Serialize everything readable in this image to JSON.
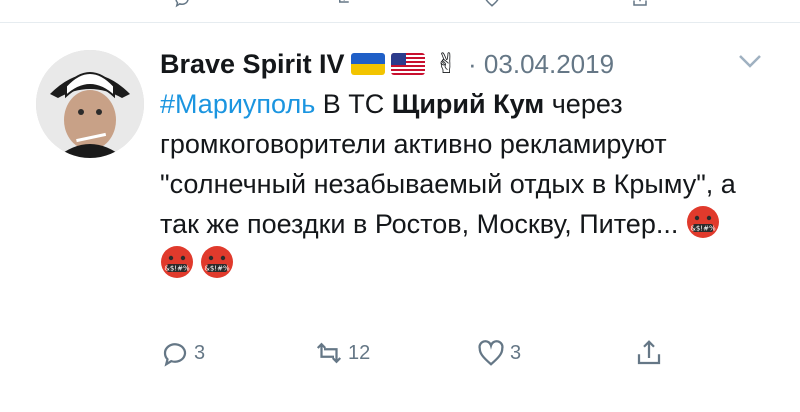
{
  "topbar": {
    "icons": [
      "reply-icon",
      "retweet-icon",
      "like-icon",
      "share-icon"
    ]
  },
  "tweet": {
    "author": {
      "display_name": "Brave Spirit IV"
    },
    "meta": "· 03.04.2019",
    "text": {
      "hashtag": "#Мариуполь",
      "part1": " В ТС ",
      "bold": "Щирий Кум",
      "part2": " через громкоговорители активно рекламируют \"солнечный незабываемый отдых в Крыму\", а так же поездки в Ростов, Москву, Питер... "
    },
    "emojis": [
      "face-with-symbols-on-mouth",
      "face-with-symbols-on-mouth",
      "face-with-symbols-on-mouth"
    ],
    "actions": {
      "reply_count": "3",
      "retweet_count": "12",
      "like_count": "3"
    }
  },
  "colors": {
    "accent": "#1b95e0",
    "muted": "#657786",
    "text": "#14171a",
    "divider": "#e6ecf0"
  }
}
